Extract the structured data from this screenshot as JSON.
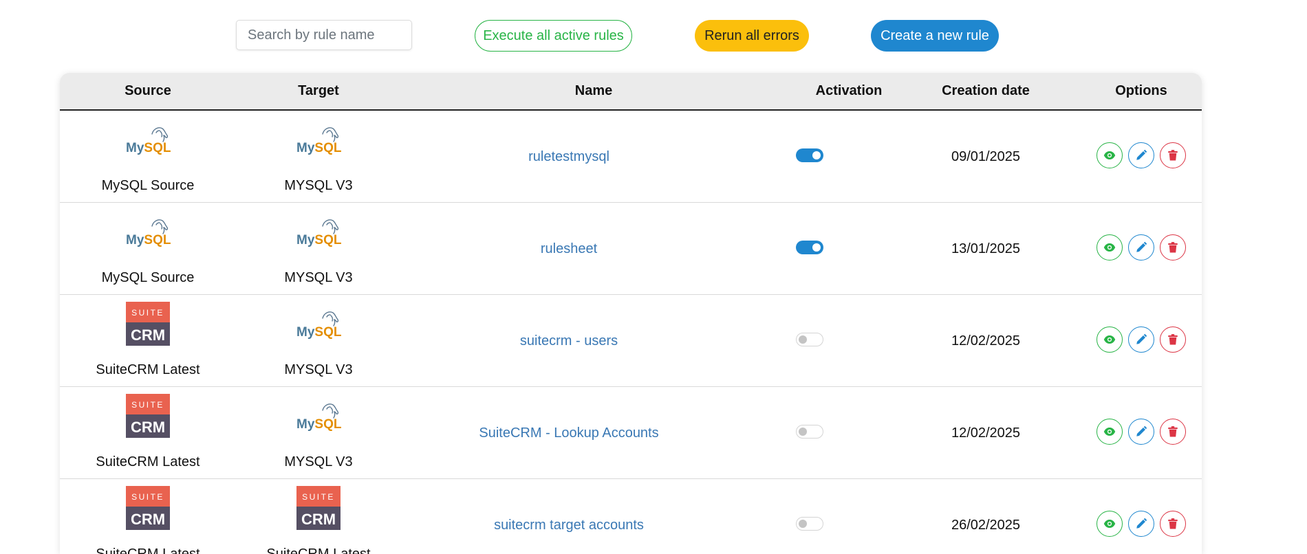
{
  "toolbar": {
    "search_placeholder": "Search by rule name",
    "execute_label": "Execute all active rules",
    "rerun_label": "Rerun all errors",
    "create_label": "Create a new rule"
  },
  "table": {
    "headers": {
      "source": "Source",
      "target": "Target",
      "name": "Name",
      "activation": "Activation",
      "creation_date": "Creation date",
      "options": "Options"
    },
    "rows": [
      {
        "source": {
          "logo": "mysql-logo",
          "name": "MySQL Source"
        },
        "target": {
          "logo": "mysql-logo",
          "name": "MYSQL V3"
        },
        "name": "ruletestmysql",
        "active": true,
        "date": "09/01/2025"
      },
      {
        "source": {
          "logo": "mysql-logo",
          "name": "MySQL Source"
        },
        "target": {
          "logo": "mysql-logo",
          "name": "MYSQL V3"
        },
        "name": "rulesheet",
        "active": true,
        "date": "13/01/2025"
      },
      {
        "source": {
          "logo": "suitecrm-logo",
          "name": "SuiteCRM Latest"
        },
        "target": {
          "logo": "mysql-logo",
          "name": "MYSQL V3"
        },
        "name": "suitecrm - users",
        "active": false,
        "date": "12/02/2025"
      },
      {
        "source": {
          "logo": "suitecrm-logo",
          "name": "SuiteCRM Latest"
        },
        "target": {
          "logo": "mysql-logo",
          "name": "MYSQL V3"
        },
        "name": "SuiteCRM - Lookup Accounts",
        "active": false,
        "date": "12/02/2025"
      },
      {
        "source": {
          "logo": "suitecrm-logo",
          "name": "SuiteCRM Latest"
        },
        "target": {
          "logo": "suitecrm-logo",
          "name": "SuiteCRM Latest"
        },
        "name": "suitecrm target accounts",
        "active": false,
        "date": "26/02/2025"
      }
    ]
  },
  "logos": {
    "mysql_text": "MySQL",
    "suite_text": "SUITE",
    "crm_text": "CRM"
  },
  "colors": {
    "primary": "#1f87cf",
    "success": "#28b446",
    "warning": "#fbbf0c",
    "danger": "#dc3545",
    "link": "#3a78b4"
  }
}
